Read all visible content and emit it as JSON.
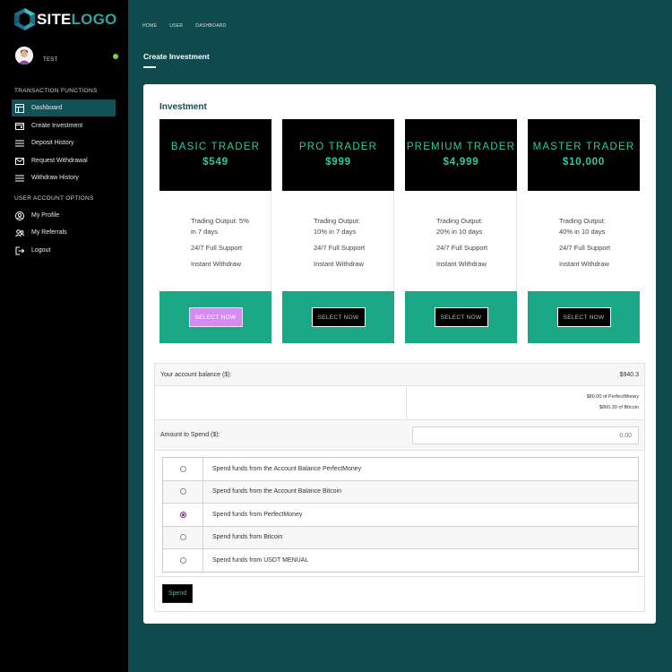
{
  "logo": {
    "text_a": "SITE",
    "text_b": "LOGO"
  },
  "user": {
    "name": "TEST"
  },
  "sidebar": {
    "section1": "TRANSACTION FUNCTIONS",
    "items1": [
      {
        "label": "Dashboard",
        "icon": "dashboard-icon",
        "active": true
      },
      {
        "label": "Create Investment",
        "icon": "investment-icon"
      },
      {
        "label": "Deposit History",
        "icon": "list-icon"
      },
      {
        "label": "Request Withdrawal",
        "icon": "mail-icon"
      },
      {
        "label": "Withdraw History",
        "icon": "list-icon"
      }
    ],
    "section2": "USER ACCOUNT OPTIONS",
    "items2": [
      {
        "label": "My Profile",
        "icon": "profile-icon"
      },
      {
        "label": "My Referrals",
        "icon": "referrals-icon"
      },
      {
        "label": "Logout",
        "icon": "logout-icon"
      }
    ]
  },
  "breadcrumb": [
    "HOME",
    "USER",
    "DASHBOARD"
  ],
  "page": {
    "title": "Create Investment"
  },
  "card": {
    "title": "Investment"
  },
  "plans": [
    {
      "name": "BASIC TRADER",
      "price": "$549",
      "output_line1": "Trading Output: 5%",
      "output_line2": "in 7 days",
      "support": "24/7 Full Support",
      "withdraw": "Instant Withdraw",
      "button": "SELECT NOW",
      "highlighted": true
    },
    {
      "name": "PRO TRADER",
      "price": "$999",
      "output_line1": "Trading Output:",
      "output_line2": "10% in 7 days",
      "support": "24/7 Full Support",
      "withdraw": "Instant Withdraw",
      "button": "SELECT NOW"
    },
    {
      "name": "PREMIUM TRADER",
      "price": "$4,999",
      "output_line1": "Trading Output:",
      "output_line2": "20% in 10 days",
      "support": "24/7 Full Support",
      "withdraw": "Instant Withdraw",
      "button": "SELECT NOW"
    },
    {
      "name": "MASTER TRADER",
      "price": "$10,000",
      "output_line1": "Trading Output:",
      "output_line2": "40% in 10 days",
      "support": "24/7 Full Support",
      "withdraw": "Instant Withdraw",
      "button": "SELECT NOW"
    }
  ],
  "balance": {
    "label": "Your account balance ($):",
    "value": "$940.3",
    "perfectmoney": "$80.00 of PerfectMoney",
    "bitcoin": "$860.30 of Bitcoin"
  },
  "amount": {
    "label": "Amount to Spend ($):",
    "placeholder": "0.00"
  },
  "options": [
    {
      "label": "Spend funds from the Account Balance PerfectMoney",
      "checked": false
    },
    {
      "label": "Spend funds from the Account Balance Bitcoin",
      "checked": false
    },
    {
      "label": "Spend funds from PerfectMoney",
      "checked": true
    },
    {
      "label": "Spend funds from Bitcoin",
      "checked": false
    },
    {
      "label": "Spend funds from USDT MENUAL",
      "checked": false
    }
  ],
  "spend_button": "Spend",
  "colors": {
    "sidebar": "#000000",
    "background": "#0f4a4f",
    "accent": "#2ccaa0",
    "plan_footer": "#1aa886",
    "highlight_button": "#d48dee"
  }
}
